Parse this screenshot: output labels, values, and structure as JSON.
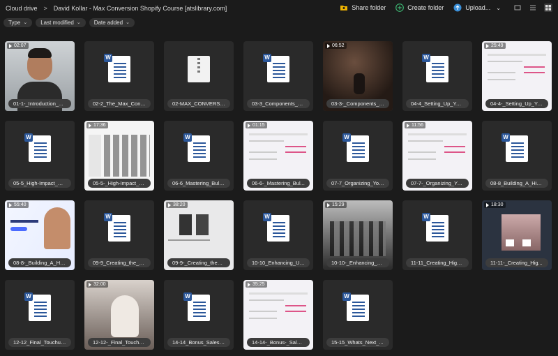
{
  "breadcrumb": {
    "root": "Cloud drive",
    "separator": ">",
    "folder": "David Kollar - Max Conversion Shopify Course [atslibrary.com]"
  },
  "toolbar": {
    "share_label": "Share folder",
    "create_label": "Create folder",
    "upload_label": "Upload...",
    "upload_chevron": "⌄"
  },
  "filters": [
    {
      "label": "Type",
      "chevron": "⌄"
    },
    {
      "label": "Last modified",
      "chevron": "⌄"
    },
    {
      "label": "Date added",
      "chevron": "⌄"
    }
  ],
  "colors": {
    "background": "#1b1b1b",
    "tile": "#2a2a2a",
    "word_blue": "#2b579a",
    "share_icon": "#f0b400",
    "create_icon": "#3cb371",
    "upload_icon": "#3a8fd8"
  },
  "files": [
    {
      "name": "01-1-_Introduction_...",
      "kind": "video",
      "duration": "02:07",
      "theme": "person"
    },
    {
      "name": "02-2_The_Max_Conv...",
      "kind": "doc",
      "icon": "word-doc-icon"
    },
    {
      "name": "02-MAX_CONVERSI...",
      "kind": "zip",
      "icon": "zip-archive-icon"
    },
    {
      "name": "03-3_Components_of...",
      "kind": "doc",
      "icon": "word-doc-icon"
    },
    {
      "name": "03-3-_Components_o...",
      "kind": "video",
      "duration": "06:52",
      "theme": "dark"
    },
    {
      "name": "04-4_Setting_Up_You...",
      "kind": "doc",
      "icon": "word-doc-icon"
    },
    {
      "name": "04-4-_Setting_Up_Yo...",
      "kind": "video",
      "duration": "25:49",
      "theme": "light"
    },
    {
      "name": "05-5_High-Impact_Pr...",
      "kind": "doc",
      "icon": "word-doc-icon"
    },
    {
      "name": "05-5-_High-Impact_P...",
      "kind": "video",
      "duration": "17:36",
      "theme": "store"
    },
    {
      "name": "06-6_Mastering_Bulk...",
      "kind": "doc",
      "icon": "word-doc-icon"
    },
    {
      "name": "06-6-_Mastering_Bul...",
      "kind": "video",
      "duration": "01:15",
      "theme": "light"
    },
    {
      "name": "07-7_Organizing_You...",
      "kind": "doc",
      "icon": "word-doc-icon"
    },
    {
      "name": "07-7-_Organizing_Yo...",
      "kind": "video",
      "duration": "11:56",
      "theme": "light"
    },
    {
      "name": "08-8_Building_A_Hig...",
      "kind": "doc",
      "icon": "word-doc-icon"
    },
    {
      "name": "08-8-_Building_A_Hig...",
      "kind": "video",
      "duration": "55:40",
      "theme": "landing"
    },
    {
      "name": "09-9_Creating_the_P...",
      "kind": "doc",
      "icon": "word-doc-icon"
    },
    {
      "name": "09-9-_Creating_the_P...",
      "kind": "video",
      "duration": "38:20",
      "theme": "web"
    },
    {
      "name": "10-10_Enhancing_Us...",
      "kind": "doc",
      "icon": "word-doc-icon"
    },
    {
      "name": "10-10-_Enhancing_Us...",
      "kind": "video",
      "duration": "15:29",
      "theme": "bw"
    },
    {
      "name": "11-11_Creating_High...",
      "kind": "doc",
      "icon": "word-doc-icon"
    },
    {
      "name": "11-11-_Creating_Hig...",
      "kind": "video",
      "duration": "18:30",
      "theme": "photo"
    },
    {
      "name": "12-12_Final_Touchup...",
      "kind": "doc",
      "icon": "word-doc-icon"
    },
    {
      "name": "12-12-_Final_Toucho...",
      "kind": "video",
      "duration": "32:00",
      "theme": "fashion"
    },
    {
      "name": "14-14_Bonus_Sales_...",
      "kind": "doc",
      "icon": "word-doc-icon"
    },
    {
      "name": "14-14-_Bonus-_Sales...",
      "kind": "video",
      "duration": "35:25",
      "theme": "light"
    },
    {
      "name": "15-15_Whats_Next_...",
      "kind": "doc",
      "icon": "word-doc-icon"
    }
  ]
}
